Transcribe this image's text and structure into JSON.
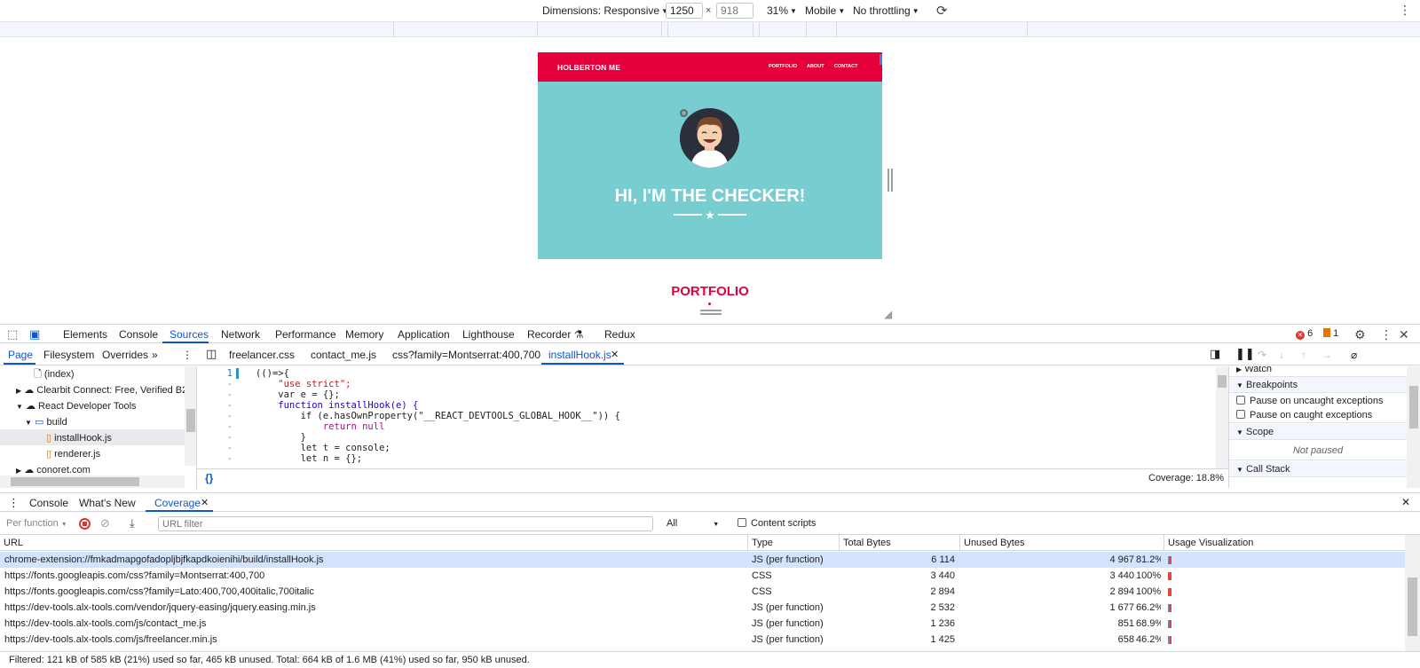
{
  "device_toolbar": {
    "dimensions_label": "Dimensions: Responsive",
    "width_value": "1250",
    "x_sep": "×",
    "height_placeholder": "918",
    "zoom": "31%",
    "device_type": "Mobile",
    "throttling": "No throttling"
  },
  "site": {
    "brand": "HOLBERTON ME",
    "nav": [
      "PORTFOLIO",
      "ABOUT",
      "CONTACT"
    ],
    "hero_title": "HI, I'M THE CHECKER!",
    "hero_divider": "★",
    "portfolio_title": "PORTFOLIO"
  },
  "devtools": {
    "main_tabs": [
      "Elements",
      "Console",
      "Sources",
      "Network",
      "Performance",
      "Memory",
      "Application",
      "Lighthouse",
      "Recorder",
      "Redux"
    ],
    "error_count": "6",
    "warning_count": "1",
    "sources_sidebar_tabs": [
      "Page",
      "Filesystem",
      "Overrides"
    ],
    "editor_tabs": [
      "freelancer.css",
      "contact_me.js",
      "css?family=Montserrat:400,700",
      "installHook.js"
    ],
    "tree": {
      "index": "(index)",
      "clearbit": "Clearbit Connect: Free, Verified B2",
      "react_devtools": "React Developer Tools",
      "build": "build",
      "install_hook": "installHook.js",
      "renderer": "renderer.js",
      "conoret": "conoret.com"
    },
    "code_lines": [
      {
        "gutter": "1",
        "text": "(()=>{"
      },
      {
        "gutter": "-",
        "text": "    \"use strict\";"
      },
      {
        "gutter": "-",
        "text": "    var e = {};"
      },
      {
        "gutter": "-",
        "text": "    function installHook(e) {"
      },
      {
        "gutter": "-",
        "text": "        if (e.hasOwnProperty(\"__REACT_DEVTOOLS_GLOBAL_HOOK__\")) {"
      },
      {
        "gutter": "-",
        "text": "            return null"
      },
      {
        "gutter": "-",
        "text": "        }"
      },
      {
        "gutter": "-",
        "text": "        let t = console;"
      },
      {
        "gutter": "-",
        "text": "        let n = {};"
      }
    ],
    "editor_coverage": "Coverage: 18.8%",
    "format_icon": "{}",
    "right_pane": {
      "watch": "Watch",
      "breakpoints": "Breakpoints",
      "pause_uncaught": "Pause on uncaught exceptions",
      "pause_caught": "Pause on caught exceptions",
      "scope": "Scope",
      "not_paused": "Not paused",
      "call_stack": "Call Stack"
    },
    "drawer_tabs": [
      "Console",
      "What's New",
      "Coverage"
    ],
    "coverage": {
      "mode": "Per function",
      "url_filter_placeholder": "URL filter",
      "type_filter": "All",
      "content_scripts": "Content scripts",
      "columns": [
        "URL",
        "Type",
        "Total Bytes",
        "Unused Bytes",
        "Usage Visualization"
      ],
      "rows": [
        {
          "url": "chrome-extension://fmkadmapgofadopljbjfkapdkoienihi/build/installHook.js",
          "type": "JS (per function)",
          "total": "6 114",
          "unused": "4 967",
          "pct": "81.2%",
          "used_frac": 0.188
        },
        {
          "url": "https://fonts.googleapis.com/css?family=Montserrat:400,700",
          "type": "CSS",
          "total": "3 440",
          "unused": "3 440",
          "pct": "100%",
          "used_frac": 0.0
        },
        {
          "url": "https://fonts.googleapis.com/css?family=Lato:400,700,400italic,700italic",
          "type": "CSS",
          "total": "2 894",
          "unused": "2 894",
          "pct": "100%",
          "used_frac": 0.0
        },
        {
          "url": "https://dev-tools.alx-tools.com/vendor/jquery-easing/jquery.easing.min.js",
          "type": "JS (per function)",
          "total": "2 532",
          "unused": "1 677",
          "pct": "66.2%",
          "used_frac": 0.338
        },
        {
          "url": "https://dev-tools.alx-tools.com/js/contact_me.js",
          "type": "JS (per function)",
          "total": "1 236",
          "unused": "851",
          "pct": "68.9%",
          "used_frac": 0.311
        },
        {
          "url": "https://dev-tools.alx-tools.com/js/freelancer.min.js",
          "type": "JS (per function)",
          "total": "1 425",
          "unused": "658",
          "pct": "46.2%",
          "used_frac": 0.538
        }
      ],
      "status": "Filtered: 121 kB of 585 kB (21%) used so far, 465 kB unused. Total: 664 kB of 1.6 MB (41%) used so far, 950 kB unused."
    },
    "colors": {
      "accent": "#0b57d0",
      "unused": "#e8453c",
      "used": "#6f8ac9",
      "brand_red": "#e4003a",
      "hero_teal": "#78cdd1"
    }
  }
}
